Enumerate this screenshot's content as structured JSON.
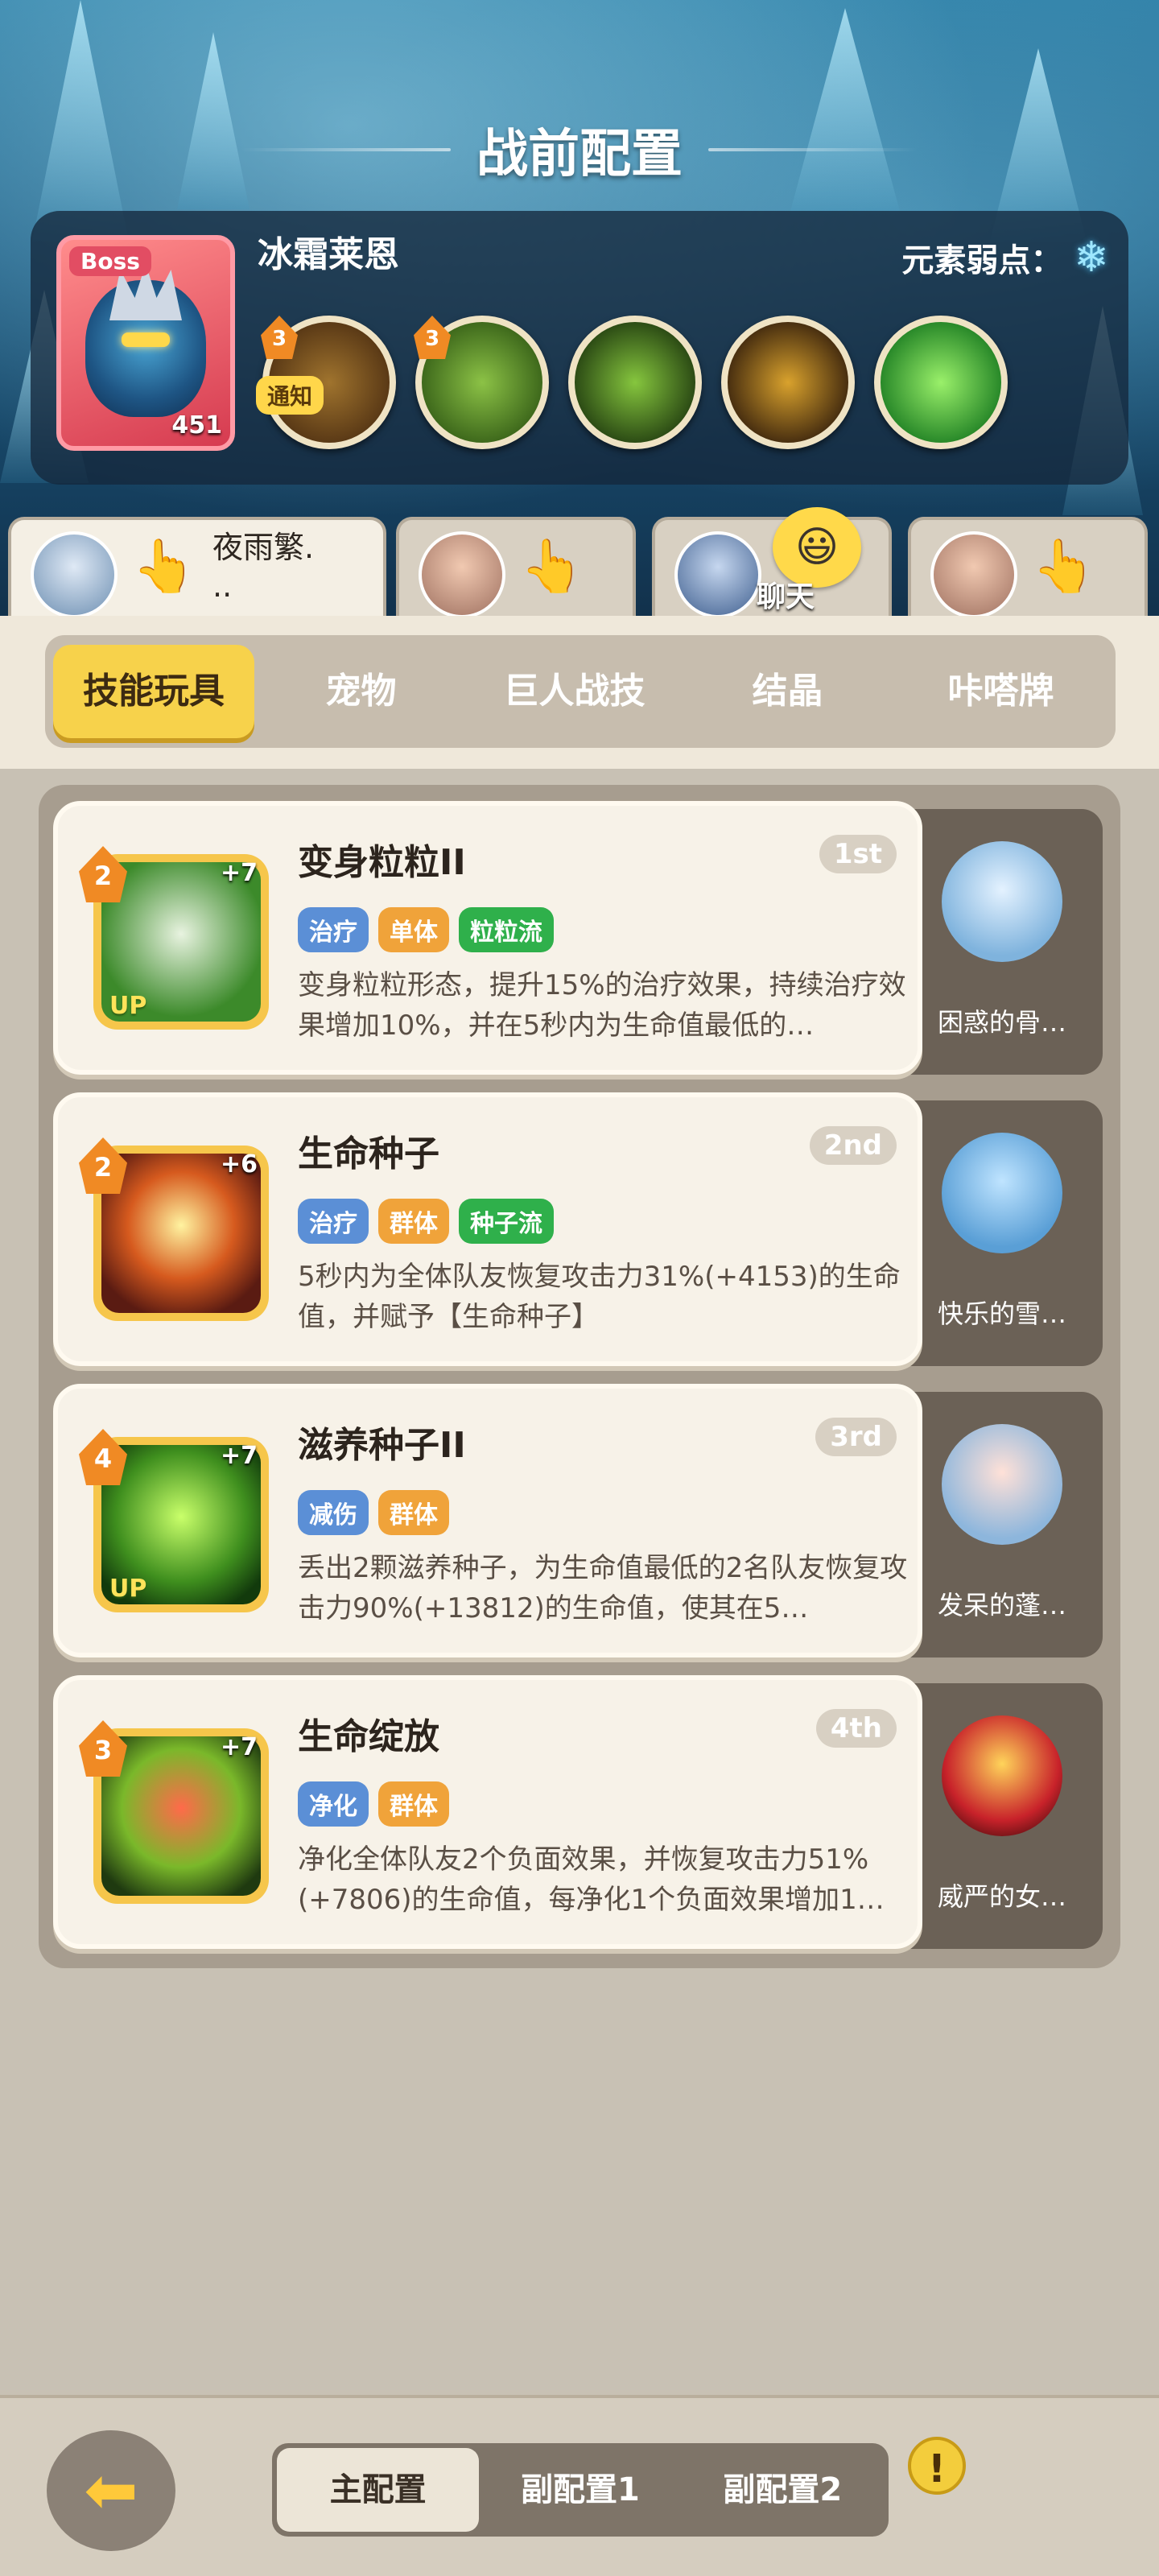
{
  "header": {
    "title": "战前配置"
  },
  "boss": {
    "badge": "Boss",
    "name": "冰霜莱恩",
    "level": "451",
    "weakness_label": "元素弱点：",
    "weakness_icon": "snowflake-icon",
    "notice_badge": "通知",
    "skills": [
      {
        "icon": "claw-slash-icon",
        "level": "3"
      },
      {
        "icon": "green-slash-icon",
        "level": "3"
      },
      {
        "icon": "spike-burst-icon",
        "level": ""
      },
      {
        "icon": "golem-icon",
        "level": ""
      },
      {
        "icon": "slime-icon",
        "level": ""
      }
    ]
  },
  "team": {
    "members": [
      {
        "name": "夜雨繁.\n..",
        "active": true
      },
      {
        "name": "",
        "active": false
      },
      {
        "name": "",
        "active": false
      },
      {
        "name": "",
        "active": false
      }
    ],
    "chat_label": "聊天"
  },
  "tabs": [
    "技能玩具",
    "宠物",
    "巨人战技",
    "结晶",
    "咔嗒牌"
  ],
  "skills": [
    {
      "name": "变身粒粒II",
      "rank": "1st",
      "level": "2",
      "plus": "+7",
      "up": "UP",
      "tags": [
        {
          "text": "治疗",
          "color": "blue"
        },
        {
          "text": "单体",
          "color": "orange"
        },
        {
          "text": "粒粒流",
          "color": "green"
        }
      ],
      "desc": "变身粒粒形态，提升15%的治疗效果，持续治疗效果增加10%，并在5秒内为生命值最低的…",
      "pet": "困惑的骨…"
    },
    {
      "name": "生命种子",
      "rank": "2nd",
      "level": "2",
      "plus": "+6",
      "up": "",
      "tags": [
        {
          "text": "治疗",
          "color": "blue"
        },
        {
          "text": "群体",
          "color": "orange"
        },
        {
          "text": "种子流",
          "color": "green"
        }
      ],
      "desc": "5秒内为全体队友恢复攻击力31%(+4153)的生命值，并赋予【生命种子】",
      "pet": "快乐的雪…"
    },
    {
      "name": "滋养种子II",
      "rank": "3rd",
      "level": "4",
      "plus": "+7",
      "up": "UP",
      "tags": [
        {
          "text": "减伤",
          "color": "blue"
        },
        {
          "text": "群体",
          "color": "orange"
        }
      ],
      "desc": "丢出2颗滋养种子，为生命值最低的2名队友恢复攻击力90%(+13812)的生命值，使其在5…",
      "pet": "发呆的蓬…"
    },
    {
      "name": "生命绽放",
      "rank": "4th",
      "level": "3",
      "plus": "+7",
      "up": "",
      "tags": [
        {
          "text": "净化",
          "color": "blue"
        },
        {
          "text": "群体",
          "color": "orange"
        }
      ],
      "desc": "净化全体队友2个负面效果，并恢复攻击力51%(+7806)的生命值，每净化1个负面效果增加1…",
      "pet": "威严的女…"
    }
  ],
  "footer": {
    "back_icon": "back-arrow-icon",
    "config_tabs": [
      "主配置",
      "副配置1",
      "副配置2"
    ],
    "info_icon": "!"
  }
}
